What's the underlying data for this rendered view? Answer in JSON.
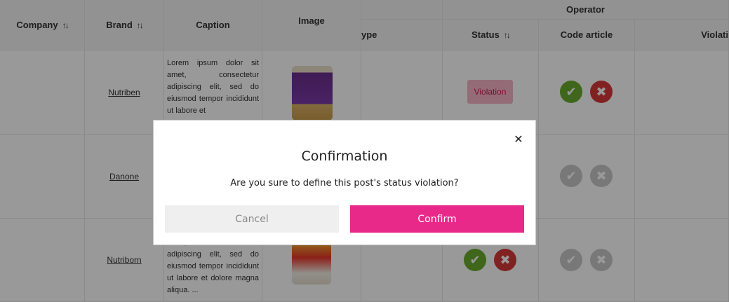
{
  "table": {
    "headers": {
      "company": "Company",
      "brand": "Brand",
      "caption": "Caption",
      "image": "Image",
      "type": "ype",
      "operator_group": "Operator",
      "status": "Status",
      "code_article": "Code article",
      "violation": "Violati"
    },
    "sort_icon": "↑↓",
    "rows": [
      {
        "brand": "Nutriben",
        "caption": "Lorem ipsum dolor sit amet, consectetur adipiscing elit, sed do eiusmod tempor incididunt ut labore et",
        "status": "Violation"
      },
      {
        "brand": "Danone",
        "caption": "",
        "status": ""
      },
      {
        "brand": "Nutriborn",
        "caption": "amet, consectetur adipiscing elit, sed do eiusmod tempor incididunt ut labore et dolore magna aliqua. ...",
        "status": ""
      }
    ]
  },
  "icons": {
    "check": "✔",
    "cross": "✖",
    "close": "✕"
  },
  "modal": {
    "title": "Confirmation",
    "message": "Are you sure to define this post's status violation?",
    "cancel_label": "Cancel",
    "confirm_label": "Confirm"
  },
  "colors": {
    "accent": "#e8298a",
    "approve": "#6aaa2c",
    "reject": "#d73a3a",
    "violation_badge_bg": "#f6b4c8",
    "violation_badge_text": "#d6194f",
    "overlay": "rgba(0,0,0,0.40)"
  }
}
